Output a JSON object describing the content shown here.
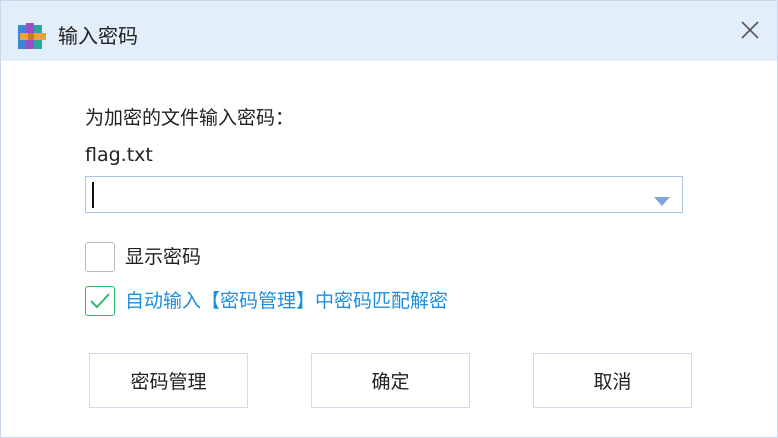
{
  "window": {
    "title": "输入密码",
    "app_icon": "winrar-books-icon",
    "close_icon": "close-icon"
  },
  "prompt": {
    "label": "为加密的文件输入密码：",
    "filename": "flag.txt"
  },
  "password_field": {
    "value": "",
    "dropdown_icon": "chevron-down-icon"
  },
  "options": {
    "show_password": {
      "label": "显示密码",
      "checked": false
    },
    "auto_fill": {
      "label": "自动输入【密码管理】中密码匹配解密",
      "checked": true
    }
  },
  "buttons": {
    "manage": "密码管理",
    "ok": "确定",
    "cancel": "取消"
  },
  "colors": {
    "titlebar": "#e3eefb",
    "accent_blue": "#1d8fe0",
    "check_green": "#2ebb6c",
    "field_border": "#a9c6e3"
  }
}
